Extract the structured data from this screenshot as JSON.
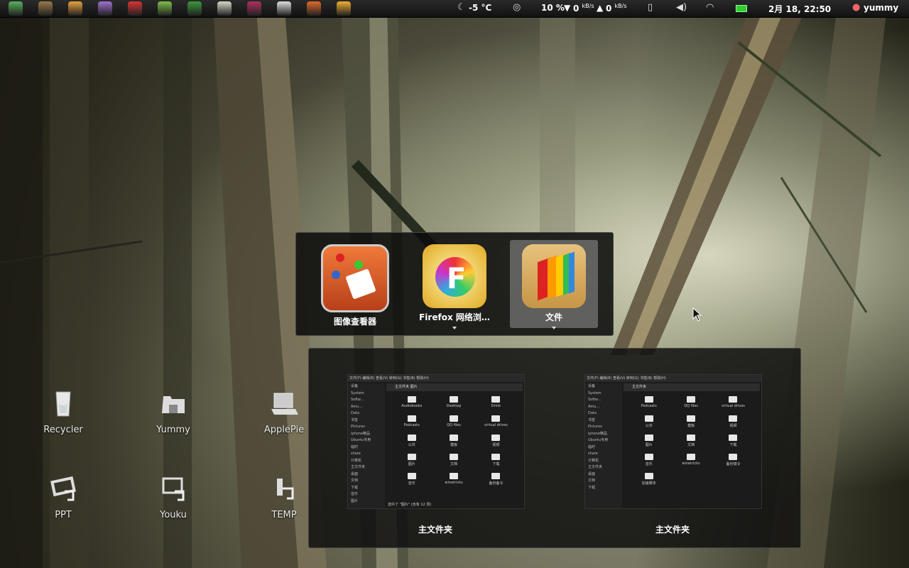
{
  "top_panel": {
    "launchers": [
      {
        "name": "mint-menu-icon",
        "color": "#56b35c"
      },
      {
        "name": "cat-app-icon",
        "color": "#9b7a4a"
      },
      {
        "name": "color-app-icon",
        "color": "#e8a23d"
      },
      {
        "name": "chat-app-icon",
        "color": "#a070d0"
      },
      {
        "name": "angry-bird-icon",
        "color": "#d33"
      },
      {
        "name": "android-icon",
        "color": "#7cbf4a"
      },
      {
        "name": "weed-app-icon",
        "color": "#3a9a3a"
      },
      {
        "name": "mahjong-icon",
        "color": "#d8d8c8"
      },
      {
        "name": "anime-app-icon",
        "color": "#b03060"
      },
      {
        "name": "zebra-app-icon",
        "color": "#dddddd"
      },
      {
        "name": "image-viewer-launcher-icon",
        "color": "#e06a2a"
      },
      {
        "name": "firefox-launcher-icon",
        "color": "#f0b030"
      }
    ],
    "weather": "-5 °C",
    "cpu": "10 %",
    "down_speed": "0",
    "up_speed": "0",
    "speed_unit": "kB/s",
    "datetime": "2月 18, 22:50",
    "user": "yummy"
  },
  "desktop_icons": [
    {
      "label": "Recycler"
    },
    {
      "label": "Yummy"
    },
    {
      "label": "ApplePie"
    },
    {
      "label": "PPT"
    },
    {
      "label": "Youku"
    },
    {
      "label": "TEMP"
    }
  ],
  "switcher": {
    "apps": [
      {
        "label": "图像查看器"
      },
      {
        "label": "Firefox 网络浏…"
      },
      {
        "label": "文件"
      }
    ]
  },
  "previews": [
    {
      "title": "主文件夹",
      "menubar": "文件(F)  编辑(E)  查看(V)  转到(G)  书签(B)  帮助(H)",
      "toolbar": "主文件夹   图片",
      "sidebar": [
        "设备",
        "System",
        "Softw…",
        "Amu…",
        "Data",
        "书签",
        "Pictures",
        "iphone精品",
        "Ubuntu专用",
        "临时",
        "share",
        "计算机",
        "主文件夹",
        "桌面",
        "文档",
        "下载",
        "音乐",
        "图片"
      ],
      "items": [
        "Audiobooks",
        "Desktop",
        "Drink",
        "Podcasts",
        "QQ files",
        "virtual drives",
        "公共",
        "模板",
        "视频",
        "图片",
        "文档",
        "下载",
        "音乐",
        "winetricks",
        "备份备令"
      ],
      "status": "选中了 \"图片\" (含有 12 项)"
    },
    {
      "title": "主文件夹",
      "menubar": "文件(F)  编辑(E)  查看(V)  转到(G)  书签(B)  帮助(H)",
      "toolbar": "主文件夹",
      "sidebar": [
        "设备",
        "System",
        "Softw…",
        "Amu…",
        "Data",
        "书签",
        "Pictures",
        "iphone精品",
        "Ubuntu专用",
        "临时",
        "share",
        "计算机",
        "主文件夹",
        "桌面",
        "文档",
        "下载"
      ],
      "items": [
        "Podcasts",
        "QQ files",
        "virtual drives",
        "公共",
        "模板",
        "视频",
        "图片",
        "文档",
        "下载",
        "音乐",
        "winetricks",
        "备份镜令",
        "加速脚本"
      ],
      "status": ""
    }
  ]
}
